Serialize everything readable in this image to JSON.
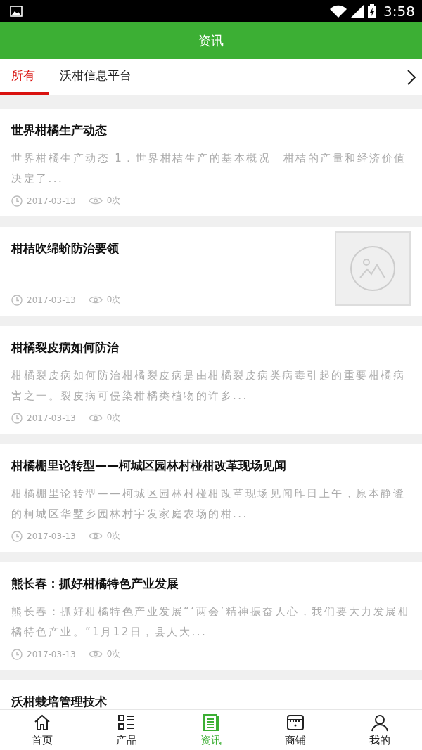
{
  "status_bar": {
    "time": "3:58"
  },
  "header": {
    "title": "资讯"
  },
  "tabs": [
    {
      "label": "所有",
      "selected": true
    },
    {
      "label": "沃柑信息平台",
      "selected": false
    }
  ],
  "articles": [
    {
      "kind": "text",
      "title": "世界柑橘生产动态",
      "summary": "世界柑橘生产动态 1．世界柑桔生产的基本概况　柑桔的产量和经济价值决定了...",
      "date": "2017-03-13",
      "views": "0次"
    },
    {
      "kind": "thumb",
      "title": "柑桔吹绵蚧防治要领",
      "date": "2017-03-13",
      "views": "0次"
    },
    {
      "kind": "text",
      "title": "柑橘裂皮病如何防治",
      "summary": "柑橘裂皮病如何防治柑橘裂皮病是由柑橘裂皮病类病毒引起的重要柑橘病害之一。裂皮病可侵染柑橘类植物的许多...",
      "date": "2017-03-13",
      "views": "0次"
    },
    {
      "kind": "text",
      "title": "柑橘棚里论转型——柯城区园林村椪柑改革现场见闻",
      "summary": "柑橘棚里论转型——柯城区园林村椪柑改革现场见闻昨日上午，原本静谧的柯城区华墅乡园林村宇发家庭农场的柑...",
      "date": "2017-03-13",
      "views": "0次"
    },
    {
      "kind": "text",
      "title": "熊长春：抓好柑橘特色产业发展",
      "summary": "熊长春：抓好柑橘特色产业发展“‘两会’精神振奋人心，我们要大力发展柑橘特色产业。”1月12日，县人大...",
      "date": "2017-03-13",
      "views": "0次"
    },
    {
      "kind": "text",
      "title": "沃柑栽培管理技术"
    }
  ],
  "bottom_nav": [
    {
      "label": "首页",
      "selected": false
    },
    {
      "label": "产品",
      "selected": false
    },
    {
      "label": "资讯",
      "selected": true
    },
    {
      "label": "商铺",
      "selected": false
    },
    {
      "label": "我的",
      "selected": false
    }
  ]
}
